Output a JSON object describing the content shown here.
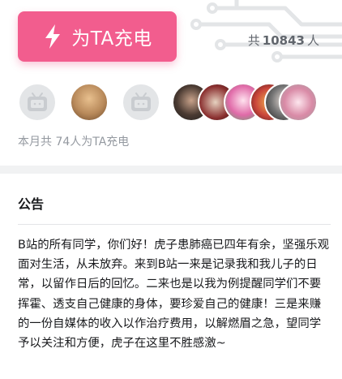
{
  "charge": {
    "button_label": "为TA充电",
    "total_prefix": "共",
    "total_count": "10843",
    "total_suffix": "人"
  },
  "supporters": {
    "avatars": [
      {
        "kind": "placeholder"
      },
      {
        "kind": "photo",
        "color": "#b8895a"
      },
      {
        "kind": "placeholder"
      },
      {
        "kind": "photo",
        "color": "#3a3a3a"
      },
      {
        "kind": "photo",
        "color": "#8a2f2f"
      },
      {
        "kind": "photo",
        "color": "#e06aa8"
      },
      {
        "kind": "photo",
        "color": "#c9453a"
      },
      {
        "kind": "photo",
        "color": "#555555"
      },
      {
        "kind": "photo",
        "color": "#d98aa6"
      }
    ],
    "month_summary": "本月共 74人为TA充电"
  },
  "notice": {
    "title": "公告",
    "body": "B站的所有同学，你们好！虎子患肺癌已四年有余，坚强乐观面对生活，从未放弃。来到B站一来是记录我和我儿子的日常，以留作日后的回忆。二来也是以我为例提醒同学们不要挥霍、透支自己健康的身体，要珍爱自己的健康！三是来赚的一份自媒体的收入以作治疗费用，以解燃眉之急，望同学予以关注和方便，虎子在这里不胜感激~"
  },
  "colors": {
    "accent": "#f25d8e",
    "muted_text": "#9499a0"
  }
}
